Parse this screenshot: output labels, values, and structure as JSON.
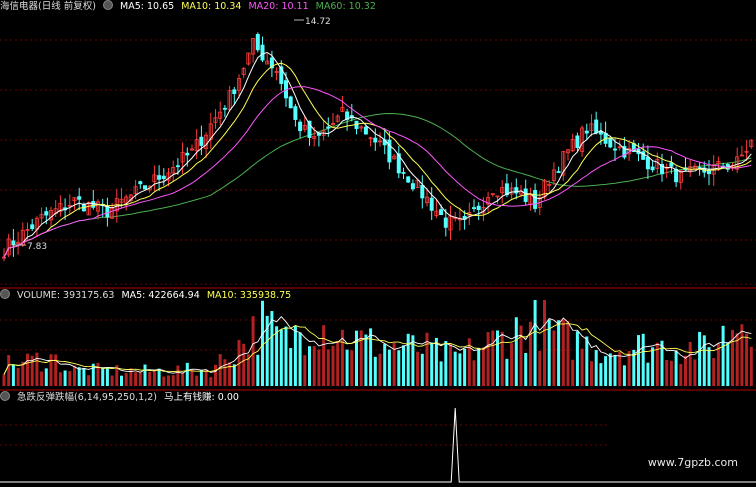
{
  "main_header": {
    "stock_title": "海信电器(日线 前复权)",
    "ma5_label": "MA5: 10.65",
    "ma10_label": "MA10: 10.34",
    "ma20_label": "MA20: 10.11",
    "ma60_label": "MA60: 10.32"
  },
  "volume_header": {
    "volume_label": "VOLUME: 393175.63",
    "ma5_label": "MA5: 422664.94",
    "ma10_label": "MA10: 335938.75"
  },
  "indicator_header": {
    "name_label": "急跌反弹跌幅(6,14,95,250,1,2)",
    "value_label": "马上有钱赚: 0.00"
  },
  "annotations": {
    "high_label": "14.72",
    "low_label": "7.83"
  },
  "watermark": "www.7gpzb.com",
  "colors": {
    "background": "#000000",
    "up": "#ff3b3b",
    "down": "#54ffff",
    "ma5": "#ffffff",
    "ma10": "#ffff55",
    "ma20": "#ff55ff",
    "ma60": "#4caf50",
    "grid": "#8b0000"
  },
  "chart_data": [
    {
      "type": "candlestick",
      "y_range": [
        7.4,
        15.2
      ],
      "annotated_high": 14.72,
      "annotated_low": 7.83,
      "anchors": [
        [
          0,
          8.4
        ],
        [
          8,
          9.3
        ],
        [
          15,
          9.8
        ],
        [
          22,
          9.5
        ],
        [
          30,
          10.2
        ],
        [
          40,
          11.2
        ],
        [
          48,
          12.8
        ],
        [
          53,
          14.3
        ],
        [
          58,
          13.6
        ],
        [
          62,
          12.1
        ],
        [
          66,
          11.5
        ],
        [
          72,
          12.3
        ],
        [
          78,
          11.7
        ],
        [
          86,
          10.5
        ],
        [
          94,
          9.2
        ],
        [
          98,
          9.1
        ],
        [
          104,
          10.2
        ],
        [
          110,
          10.0
        ],
        [
          113,
          9.7
        ],
        [
          117,
          10.7
        ],
        [
          124,
          11.9
        ],
        [
          130,
          11.4
        ],
        [
          136,
          11.0
        ],
        [
          144,
          10.5
        ],
        [
          150,
          10.7
        ],
        [
          156,
          10.9
        ],
        [
          159,
          11.5
        ]
      ],
      "series": [
        {
          "name": "MA5",
          "value": 10.65
        },
        {
          "name": "MA10",
          "value": 10.34
        },
        {
          "name": "MA20",
          "value": 10.11
        },
        {
          "name": "MA60",
          "value": 10.32
        }
      ]
    },
    {
      "type": "bar",
      "title": "VOLUME",
      "values_labelled": {
        "VOLUME": 393175.63,
        "MA5": 422664.94,
        "MA10": 335938.75
      },
      "spikes": [
        [
          0,
          0.25
        ],
        [
          10,
          0.35
        ],
        [
          14,
          0.2
        ],
        [
          30,
          0.18
        ],
        [
          44,
          0.2
        ],
        [
          55,
          0.75
        ],
        [
          60,
          0.55
        ],
        [
          66,
          0.8
        ],
        [
          72,
          0.6
        ],
        [
          80,
          0.5
        ],
        [
          90,
          0.45
        ],
        [
          96,
          0.35
        ],
        [
          104,
          0.55
        ],
        [
          114,
          0.8
        ],
        [
          118,
          0.6
        ],
        [
          128,
          0.45
        ],
        [
          138,
          0.5
        ],
        [
          150,
          0.45
        ],
        [
          158,
          0.9
        ]
      ]
    },
    {
      "type": "line",
      "title": "急跌反弹跌幅(6,14,95,250,1,2)",
      "series": [
        {
          "name": "马上有钱赚",
          "value": 0.0
        }
      ],
      "signal_spike_index": 96
    }
  ]
}
